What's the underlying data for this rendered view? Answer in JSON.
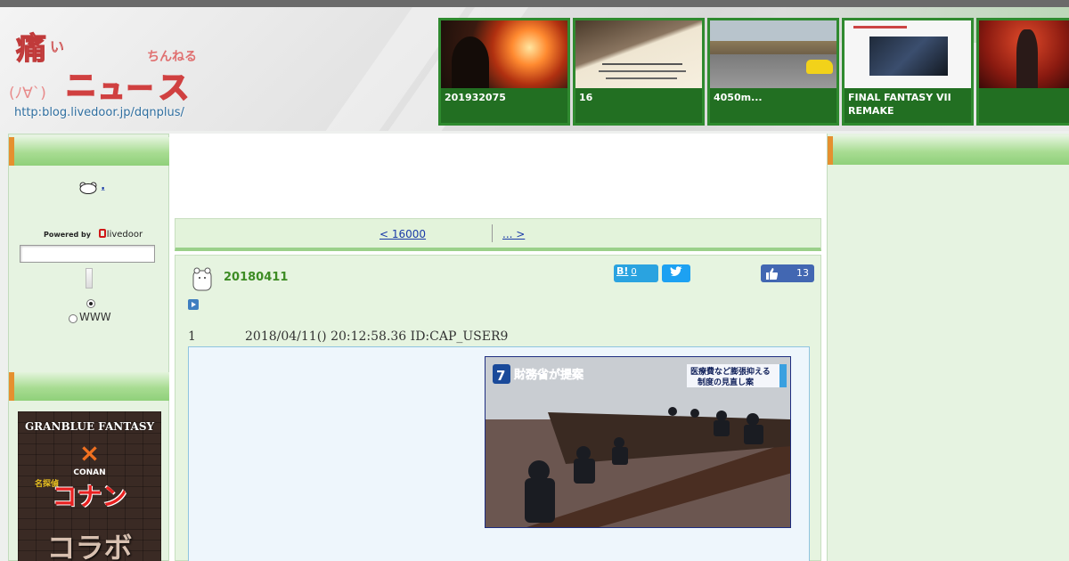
{
  "header": {
    "logo": {
      "title_chars": [
        "痛",
        "い",
        "ニ",
        "ュ",
        "ー",
        "ス"
      ],
      "subtitle": "ちんねる",
      "face": "(ﾉ∀`)",
      "url": "http:blog.livedoor.jp/dqnplus/"
    },
    "thumbnails": [
      {
        "caption": "201932075",
        "icon": "explosion-photo"
      },
      {
        "caption": "16",
        "icon": "paper-note-photo"
      },
      {
        "caption": "4050m...",
        "icon": "highway-car-photo"
      },
      {
        "caption": "FINAL FANTASY VII REMAKE",
        "icon": "game-screenshot-photo"
      },
      {
        "caption": "",
        "icon": "guitarist-photo"
      }
    ]
  },
  "left_sidebar": {
    "bear_link": "ᴥ",
    "powered_by": "Powered by",
    "livedoor": "livedoor",
    "search_value": "",
    "www_label": "WWW",
    "banner": {
      "line1": "GRANBLUE FANTASY",
      "line2": "×",
      "line3": "CONAN",
      "line3b": "名探偵",
      "line4": "コナン",
      "line5": "コラボ"
    }
  },
  "pager": {
    "prev": "<  16000          ",
    "next": "...  >    "
  },
  "article": {
    "title": "20180411",
    "hatena": "B!",
    "hatena_count": "0",
    "like_count": "13",
    "res_number": "1",
    "meta": "2018/04/11() 20:12:58.36 ID:CAP_USER9",
    "image": {
      "channel": "7",
      "caption_left": "財務省が提案",
      "caption_right_1": "医療費など膨張抑える",
      "caption_right_2": "制度の見直し案"
    }
  },
  "colors": {
    "accent_green": "#3d8c24",
    "thumb_green": "#226f22",
    "link_blue": "#1a3aa8",
    "sidebar_bg": "#e6f3e1",
    "orange_tab": "#e5902f"
  }
}
